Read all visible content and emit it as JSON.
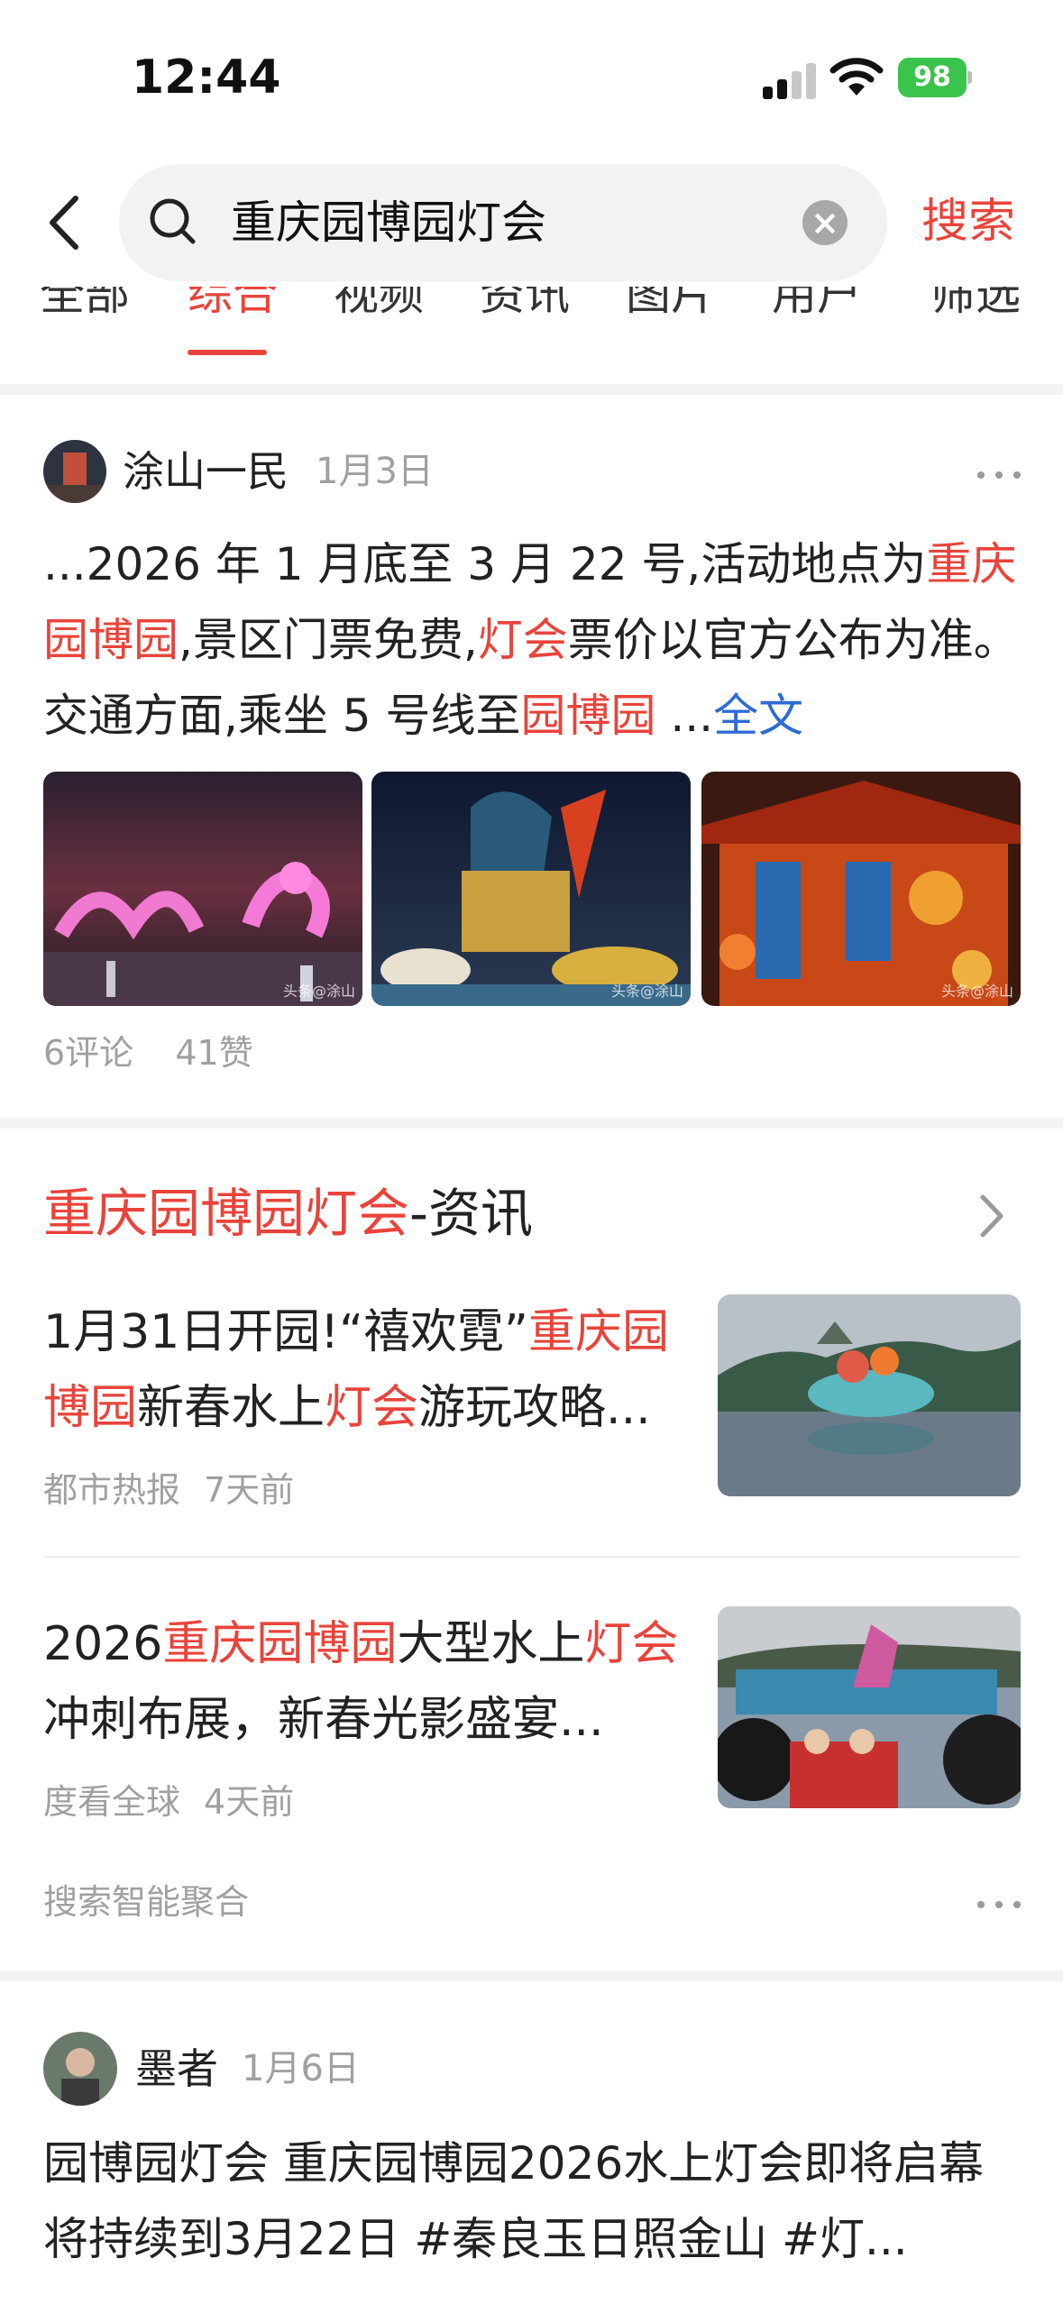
{
  "status_bar": {
    "time": "12:44",
    "battery": "98"
  },
  "search": {
    "query": "重庆园博园灯会",
    "submit_label": "搜索"
  },
  "tabs": [
    "全部",
    "综合",
    "视频",
    "资讯",
    "图片",
    "用户",
    "筛选"
  ],
  "post1": {
    "author": "涂山一民",
    "date": "1月3日",
    "text_parts": [
      {
        "t": "...2026 年 1 月底至 3 月 22 号,活动地点为",
        "hl": false
      },
      {
        "t": "重庆园博园",
        "hl": true
      },
      {
        "t": ",景区门票免费,",
        "hl": false
      },
      {
        "t": "灯会",
        "hl": true
      },
      {
        "t": "票价以官方公布为准。交通方面,乘坐 5 号线至",
        "hl": false
      },
      {
        "t": "园博园",
        "hl": true
      },
      {
        "t": " ...",
        "hl": false
      }
    ],
    "full_text_link": "全文",
    "watermark": "头条@涂山",
    "comments": "6评论",
    "likes": "41赞"
  },
  "news_section": {
    "title_highlight": "重庆园博园灯会",
    "title_suffix": "-资讯",
    "items": [
      {
        "title_parts": [
          {
            "t": "1月31日开园!“禧欢霓”",
            "hl": false
          },
          {
            "t": "重庆园博园",
            "hl": true
          },
          {
            "t": "新春水上",
            "hl": false
          },
          {
            "t": "灯会",
            "hl": true
          },
          {
            "t": "游玩攻略...",
            "hl": false
          }
        ],
        "source": "都市热报",
        "time": "7天前"
      },
      {
        "title_parts": [
          {
            "t": "2026",
            "hl": false
          },
          {
            "t": "重庆园博园",
            "hl": true
          },
          {
            "t": "大型水上",
            "hl": false
          },
          {
            "t": "灯会",
            "hl": true
          },
          {
            "t": "冲刺布展，新春光影盛宴...",
            "hl": false
          }
        ],
        "source": "度看全球",
        "time": "4天前"
      }
    ],
    "aggregation_label": "搜索智能聚合"
  },
  "post2": {
    "author": "墨者",
    "date": "1月6日",
    "text": "园博园灯会 重庆园博园2026水上灯会即将启幕 将持续到3月22日 #秦良玉日照金山 #灯..."
  },
  "colors": {
    "accent": "#e8443b",
    "link": "#2e6bd2",
    "meta": "#a0a0a0"
  }
}
